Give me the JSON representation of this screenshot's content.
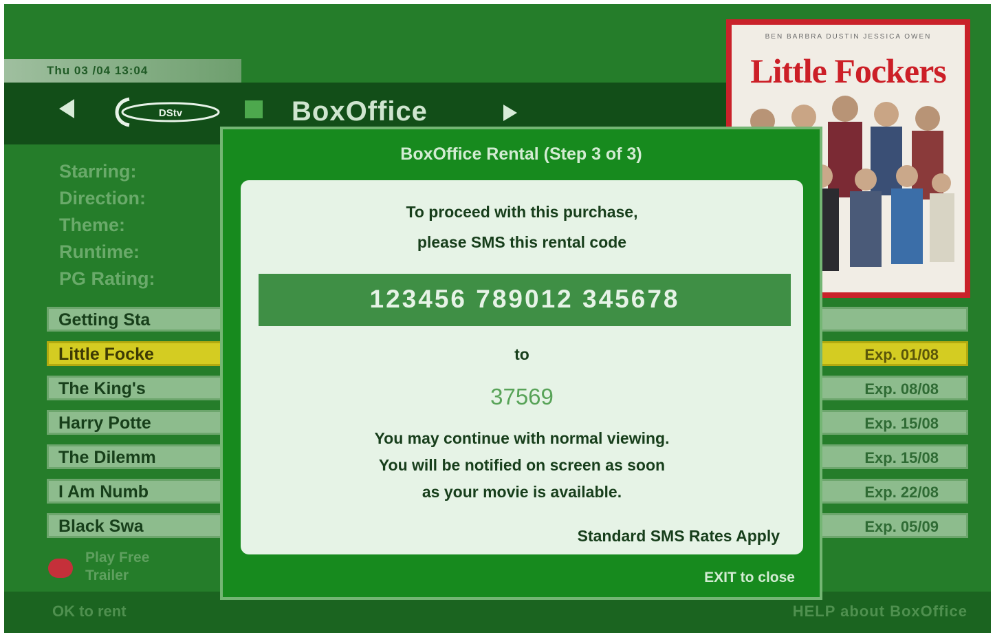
{
  "header": {
    "datetime": "Thu 03 /04 13:04",
    "logo_text": "DStv",
    "channel_title": "BoxOffice"
  },
  "poster": {
    "tagline": "BEN   BARBRA   DUSTIN   JESSICA   OWEN",
    "title": "Little Fockers"
  },
  "details": {
    "labels": [
      "Starring:",
      "Direction:",
      "Theme:",
      "Runtime:",
      "PG Rating:"
    ]
  },
  "list": {
    "items": [
      {
        "title": "Getting Sta",
        "expiry": ""
      },
      {
        "title": "Little Focke",
        "expiry": "Exp. 01/08"
      },
      {
        "title": "The King's",
        "expiry": "Exp. 08/08"
      },
      {
        "title": "Harry Potte",
        "expiry": "Exp. 15/08"
      },
      {
        "title": "The Dilemm",
        "expiry": "Exp. 15/08"
      },
      {
        "title": "I Am Numb",
        "expiry": "Exp. 22/08"
      },
      {
        "title": "Black Swa",
        "expiry": "Exp. 05/09"
      }
    ]
  },
  "trailer": {
    "line1": "Play Free",
    "line2": "Trailer"
  },
  "footer": {
    "ok_label": "OK   to rent",
    "help_label": "HELP   about BoxOffice"
  },
  "dialog": {
    "title": "BoxOffice Rental (Step 3 of 3)",
    "instruction_line1": "To proceed with this purchase,",
    "instruction_line2": "please SMS this rental code",
    "rental_code": "123456 789012 345678",
    "to_label": "to",
    "sms_number": "37569",
    "notice_line1": "You may continue with normal viewing.",
    "notice_line2": "You will be notified on screen as soon",
    "notice_line3": "as your movie is available.",
    "rates_note": "Standard SMS Rates Apply",
    "exit_label": "EXIT to close"
  },
  "colors": {
    "background": "#257d2a",
    "dialog": "#178a1e",
    "panel": "#e6f3e6",
    "selected_row": "#d4cc22",
    "poster_red": "#cc1f27"
  }
}
